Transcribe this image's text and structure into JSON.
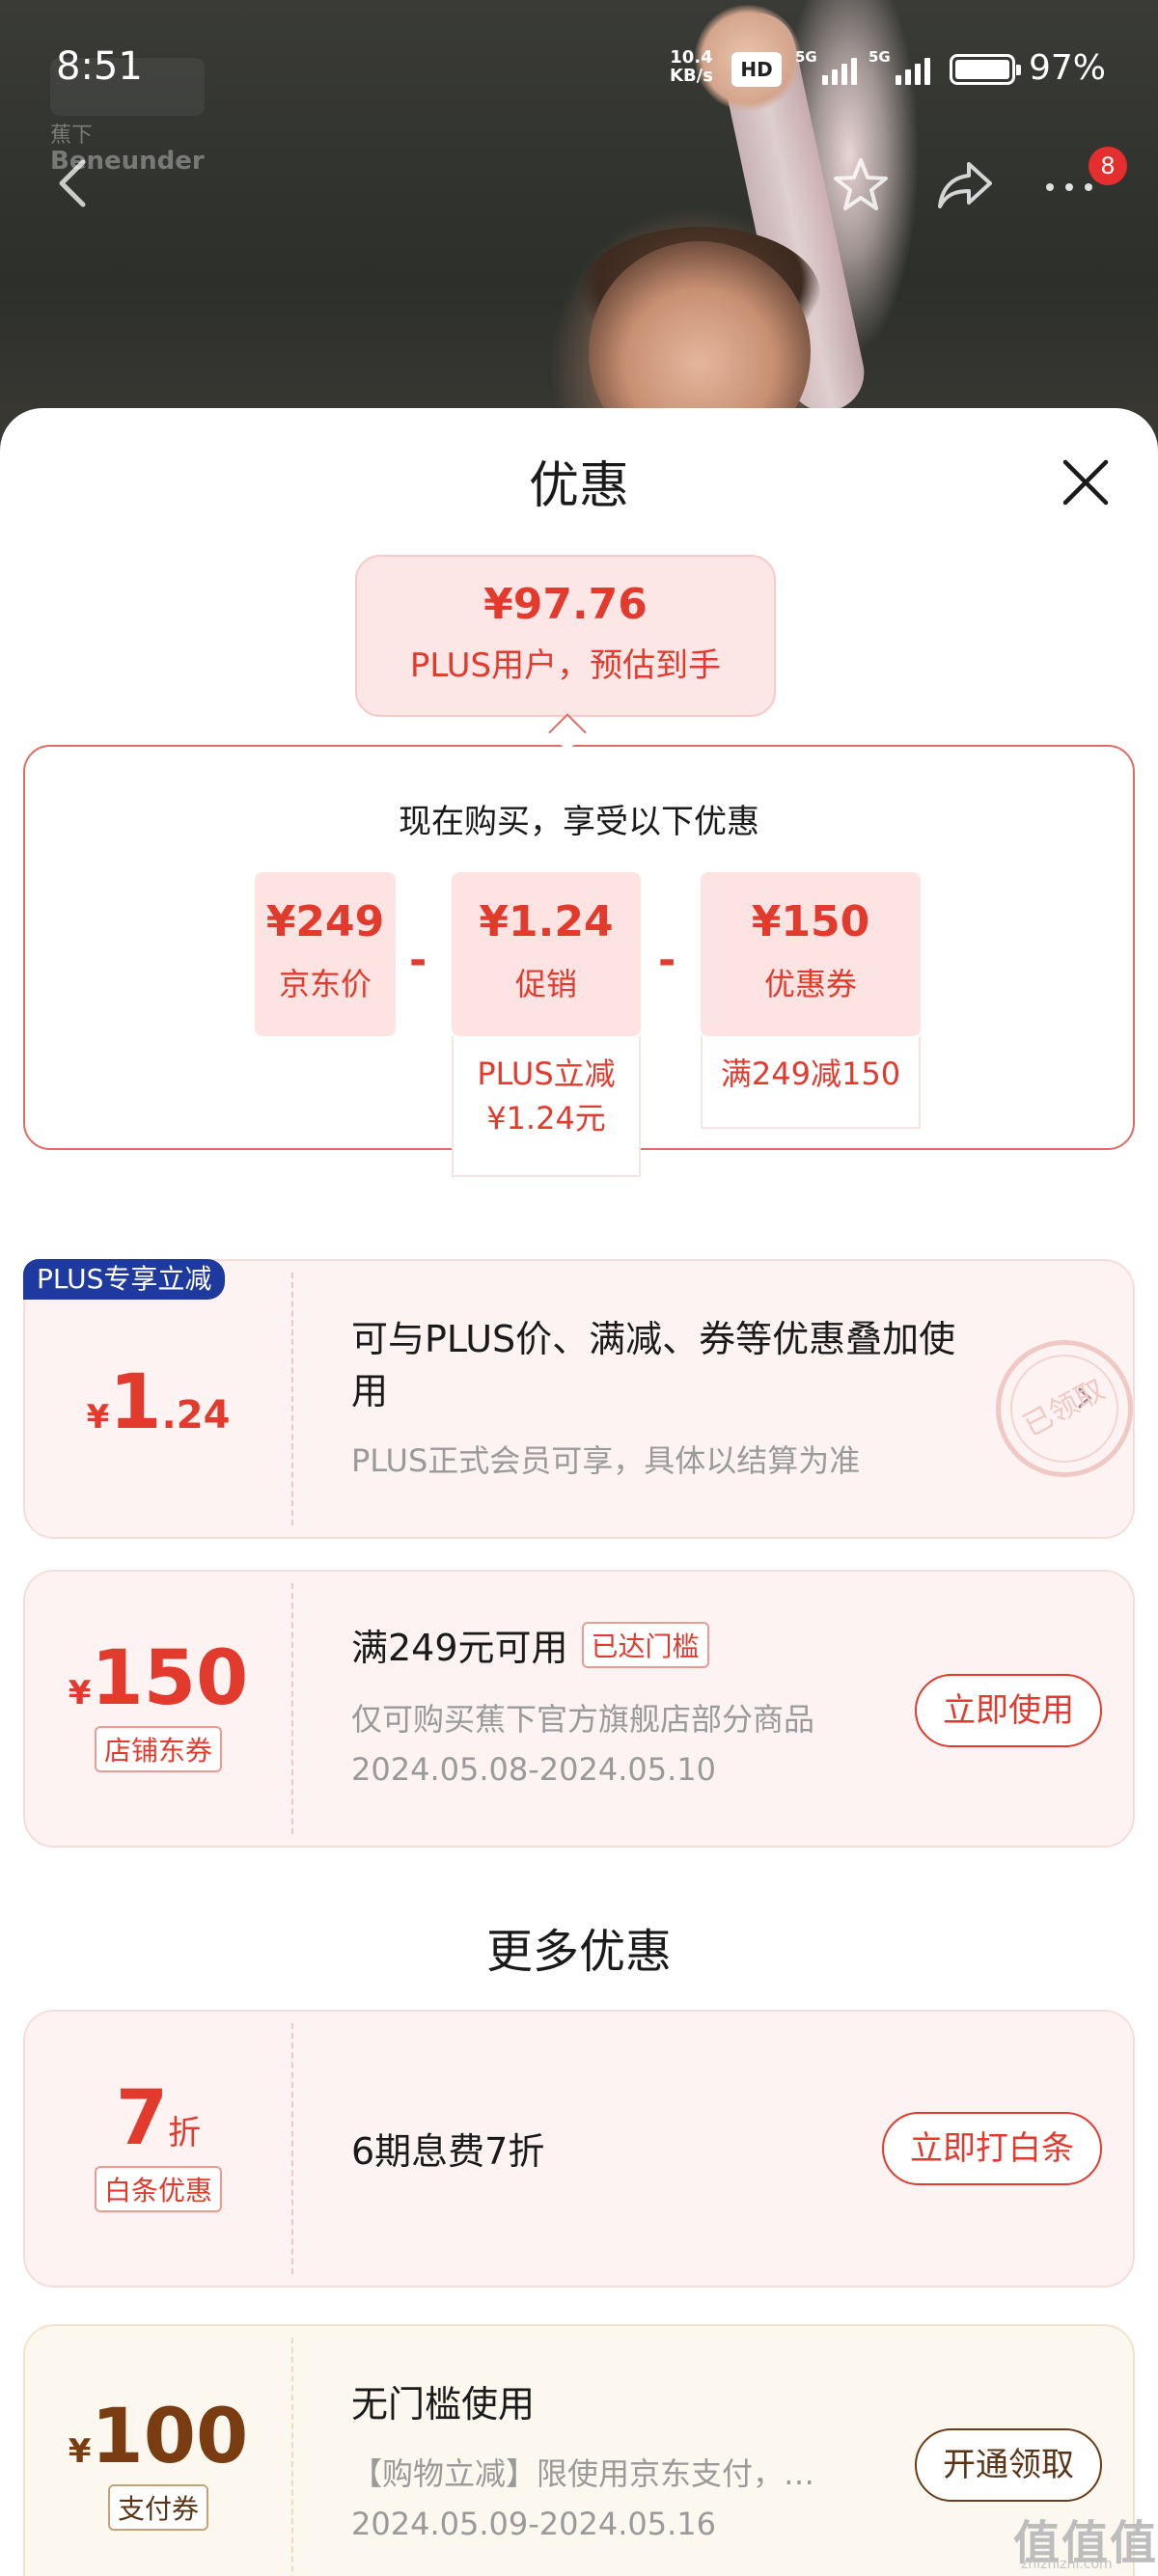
{
  "status_bar": {
    "time": "8:51",
    "net_speed_value": "10.4",
    "net_speed_unit": "KB/s",
    "hd_label": "HD",
    "network_1": "5G",
    "network_2": "5G",
    "battery": "97%"
  },
  "brand": {
    "name_cn": "蕉下",
    "name_en": "Beneunder"
  },
  "nav": {
    "cart_badge": "8"
  },
  "sheet": {
    "title": "优惠",
    "estimate": {
      "price": "¥97.76",
      "label": "PLUS用户，预估到手"
    },
    "calc": {
      "title": "现在购买，享受以下优惠",
      "minus": "-",
      "items": [
        {
          "value": "¥249",
          "label": "京东价"
        },
        {
          "value": "¥1.24",
          "label": "促销",
          "note": "PLUS立减\n¥1.24元"
        },
        {
          "value": "¥150",
          "label": "优惠券",
          "note": "满249减150"
        }
      ]
    },
    "plus_card": {
      "tag": "PLUS专享立减",
      "currency": "¥",
      "amount_int": "1",
      "amount_dec": ".24",
      "title": "可与PLUS价、满减、券等优惠叠加使用",
      "subtitle": "PLUS正式会员可享，具体以结算为准"
    },
    "coupon_card": {
      "currency": "¥",
      "amount": "150",
      "type_tag": "店铺东券",
      "title": "满249元可用",
      "status_tag": "已达门槛",
      "desc": "仅可购买蕉下官方旗舰店部分商品",
      "date": "2024.05.08-2024.05.10",
      "button": "立即使用",
      "stamp": "已领取"
    },
    "more_title": "更多优惠",
    "baitiao_card": {
      "amount": "7",
      "unit": "折",
      "type_tag": "白条优惠",
      "title": "6期息费7折",
      "button": "立即打白条"
    },
    "pay_card": {
      "currency": "¥",
      "amount": "100",
      "type_tag": "支付券",
      "title": "无门槛使用",
      "desc": "【购物立减】限使用京东支付，…",
      "date": "2024.05.09-2024.05.16",
      "button": "开通领取"
    }
  },
  "watermark": {
    "logo": "值值值",
    "site": "zhizhizhi.com"
  },
  "colors": {
    "accent_red": "#e23b2e",
    "plus_blue": "#1f3a9e",
    "brown": "#7a3d12"
  }
}
